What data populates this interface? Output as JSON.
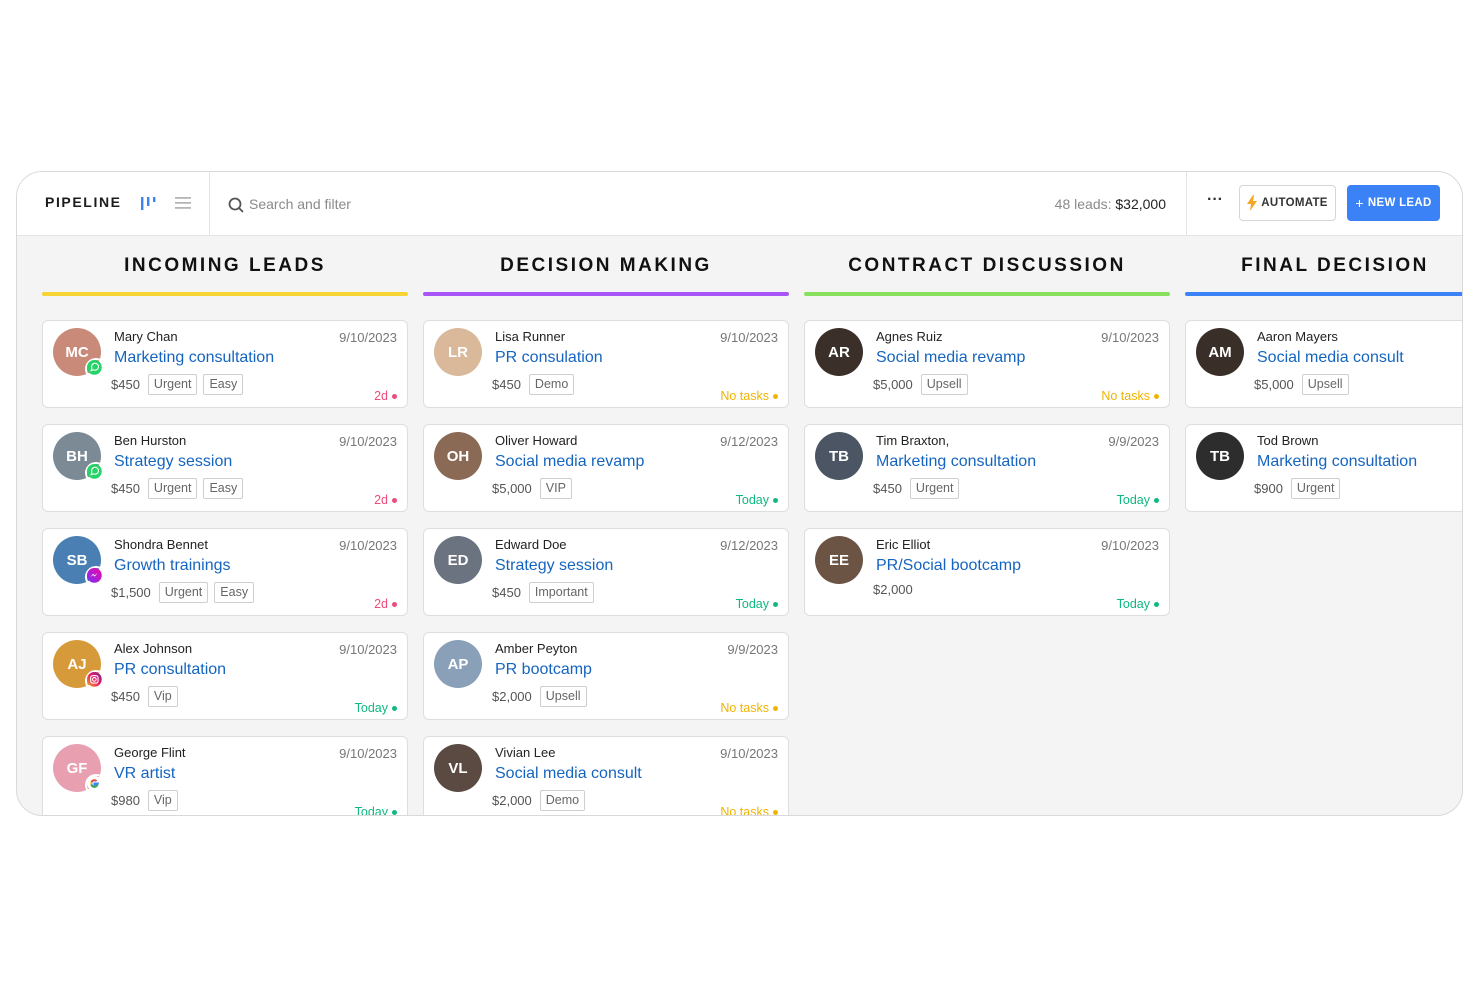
{
  "header": {
    "title": "PIPELINE",
    "search_placeholder": "Search and filter",
    "leads_count_label": "48 leads:",
    "leads_total": "$32,000",
    "automate_label": "AUTOMATE",
    "new_lead_label": "NEW LEAD"
  },
  "colors": {
    "accent": "#3b82f6",
    "link": "#1565c0",
    "due_overdue": "#ef4b7c",
    "due_today": "#10b981",
    "no_tasks": "#f0b400"
  },
  "columns": [
    {
      "title": "INCOMING LEADS",
      "color": "#f5d433",
      "cards": [
        {
          "name": "Mary Chan",
          "date": "9/10/2023",
          "title": "Marketing consultation",
          "price": "$450",
          "tags": [
            "Urgent",
            "Easy"
          ],
          "status": "2d",
          "status_type": "overdue",
          "initials": "MC",
          "avatar_color": "#c98a7a",
          "channel": "whatsapp-icon"
        },
        {
          "name": "Ben Hurston",
          "date": "9/10/2023",
          "title": "Strategy session",
          "price": "$450",
          "tags": [
            "Urgent",
            "Easy"
          ],
          "status": "2d",
          "status_type": "overdue",
          "initials": "BH",
          "avatar_color": "#7c8a96",
          "channel": "whatsapp-icon"
        },
        {
          "name": "Shondra Bennet",
          "date": "9/10/2023",
          "title": "Growth trainings",
          "price": "$1,500",
          "tags": [
            "Urgent",
            "Easy"
          ],
          "status": "2d",
          "status_type": "overdue",
          "initials": "SB",
          "avatar_color": "#4a7fb3",
          "channel": "messenger-icon"
        },
        {
          "name": "Alex Johnson",
          "date": "9/10/2023",
          "title": "PR consultation",
          "price": "$450",
          "tags": [
            "Vip"
          ],
          "status": "Today",
          "status_type": "today",
          "initials": "AJ",
          "avatar_color": "#d79a3a",
          "channel": "instagram-icon"
        },
        {
          "name": "George Flint",
          "date": "9/10/2023",
          "title": "VR artist",
          "price": "$980",
          "tags": [
            "Vip"
          ],
          "status": "Today",
          "status_type": "today",
          "initials": "GF",
          "avatar_color": "#e8a0b0",
          "channel": "google-icon"
        }
      ]
    },
    {
      "title": "DECISION MAKING",
      "color": "#a855f7",
      "cards": [
        {
          "name": "Lisa Runner",
          "date": "9/10/2023",
          "title": "PR consulation",
          "price": "$450",
          "tags": [
            "Demo"
          ],
          "status": "No tasks",
          "status_type": "notasks",
          "initials": "LR",
          "avatar_color": "#d9b99a"
        },
        {
          "name": "Oliver Howard",
          "date": "9/12/2023",
          "title": "Social media revamp",
          "price": "$5,000",
          "tags": [
            "VIP"
          ],
          "status": "Today",
          "status_type": "today",
          "initials": "OH",
          "avatar_color": "#8b6a55"
        },
        {
          "name": "Edward Doe",
          "date": "9/12/2023",
          "title": "Strategy session",
          "price": "$450",
          "tags": [
            "Important"
          ],
          "status": "Today",
          "status_type": "today",
          "initials": "ED",
          "avatar_color": "#6b7280"
        },
        {
          "name": "Amber Peyton",
          "date": "9/9/2023",
          "title": "PR bootcamp",
          "price": "$2,000",
          "tags": [
            "Upsell"
          ],
          "status": "No tasks",
          "status_type": "notasks",
          "initials": "AP",
          "avatar_color": "#8aa0b8"
        },
        {
          "name": "Vivian Lee",
          "date": "9/10/2023",
          "title": "Social media consult",
          "price": "$2,000",
          "tags": [
            "Demo"
          ],
          "status": "No tasks",
          "status_type": "notasks",
          "initials": "VL",
          "avatar_color": "#5b4a42"
        }
      ]
    },
    {
      "title": "CONTRACT DISCUSSION",
      "color": "#86e05c",
      "cards": [
        {
          "name": "Agnes Ruiz",
          "date": "9/10/2023",
          "title": "Social media revamp",
          "price": "$5,000",
          "tags": [
            "Upsell"
          ],
          "status": "No tasks",
          "status_type": "notasks",
          "initials": "AR",
          "avatar_color": "#3b2f2a"
        },
        {
          "name": "Tim Braxton,",
          "date": "9/9/2023",
          "title": "Marketing consultation",
          "price": "$450",
          "tags": [
            "Urgent"
          ],
          "status": "Today",
          "status_type": "today",
          "initials": "TB",
          "avatar_color": "#4b5563"
        },
        {
          "name": "Eric Elliot",
          "date": "9/10/2023",
          "title": "PR/Social bootcamp",
          "price": "$2,000",
          "tags": [],
          "status": "Today",
          "status_type": "today",
          "initials": "EE",
          "avatar_color": "#6b5444"
        }
      ]
    },
    {
      "title": "FINAL DECISION",
      "color": "#3b82f6",
      "cards": [
        {
          "name": "Aaron Mayers",
          "date": "",
          "title": "Social media consult",
          "price": "$5,000",
          "tags": [
            "Upsell"
          ],
          "status": "",
          "status_type": "",
          "initials": "AM",
          "avatar_color": "#3a2e28"
        },
        {
          "name": "Tod Brown",
          "date": "",
          "title": "Marketing consultation",
          "price": "$900",
          "tags": [
            "Urgent"
          ],
          "status": "",
          "status_type": "",
          "initials": "TB",
          "avatar_color": "#2d2d2d"
        }
      ]
    }
  ]
}
